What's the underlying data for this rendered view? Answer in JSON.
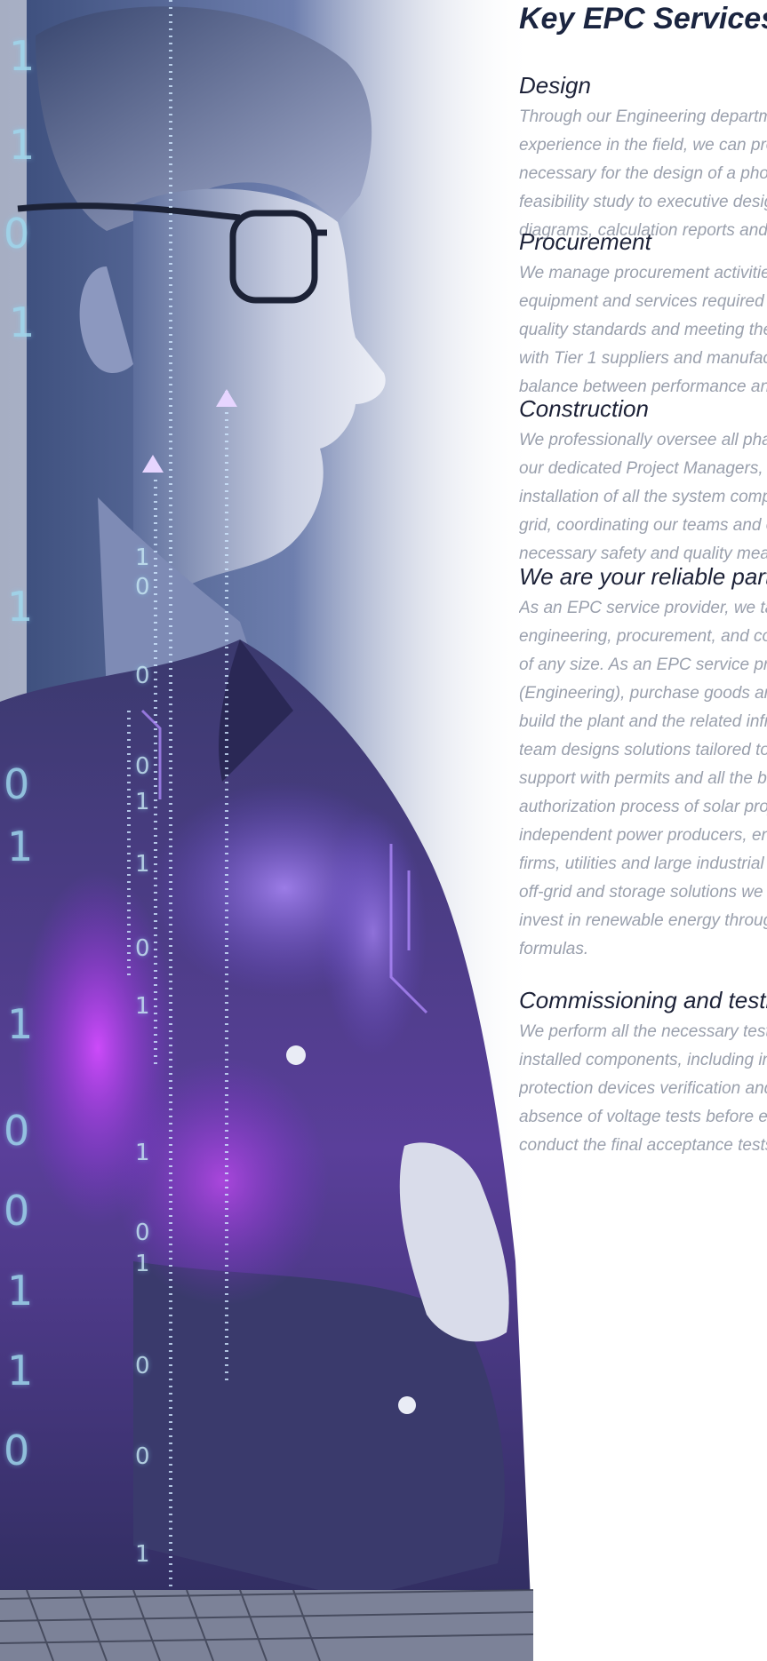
{
  "title": "Key EPC Services",
  "sections": [
    {
      "heading": "Design",
      "body": "Through our Engineering department and our many years of experience in the field, we can produce all the documentation necessary for the design of a photovoltaic system, from the feasibility study to executive design: site plans, single-line diagrams, calculation reports and technical specifications."
    },
    {
      "heading": "Procurement",
      "body": "We manage procurement activities, purchasing all the materials, equipment and services required for the project, guaranteeing quality standards and meeting the specified timelines. We partner with Tier 1 suppliers and manufacturers to ensure the best balance between performance and cost."
    },
    {
      "heading": "Construction",
      "body": "We professionally oversee all phases of the construction through our dedicated Project Managers, from site preparation to the installation of all the system components and connection to the grid, coordinating our teams and our subcontractors with all the necessary safety and quality measures."
    },
    {
      "heading": "We are your reliable partner",
      "body": "As an EPC service provider, we take full responsibility for the engineering, procurement, and construction of photovoltaic plants of any size. As an EPC service provider, we design the system (Engineering), purchase goods and services (Procurement), and build the plant and the related infrastructure. Our engineering team designs solutions tailored to site conditions. We provide support with permits and all the bureaucratic matters related to the authorization process of solar projects. Our primary clients are independent power producers, energy companies, investment firms, utilities and large industrial customers. Additionally, with our off-grid and storage solutions we support companies looking to invest in renewable energy through Leasing or operative rental formulas."
    },
    {
      "heading": "Commissioning and testing",
      "body": "We perform all the necessary tests and inspections on the installed components, including insulation tests, string checks, protection devices verification and the grid distributor network absence of voltage tests before energization. In FAC phase, we conduct the final acceptance tests."
    }
  ],
  "hero": {
    "binary_big": [
      "1",
      "1",
      "0",
      "1",
      "1",
      "0",
      "1",
      "1",
      "0",
      "0",
      "1",
      "1",
      "0"
    ],
    "binary_small": [
      "1",
      "0",
      "0",
      "0",
      "1",
      "1",
      "0",
      "1",
      "1",
      "0",
      "1",
      "0",
      "0",
      "1"
    ]
  }
}
